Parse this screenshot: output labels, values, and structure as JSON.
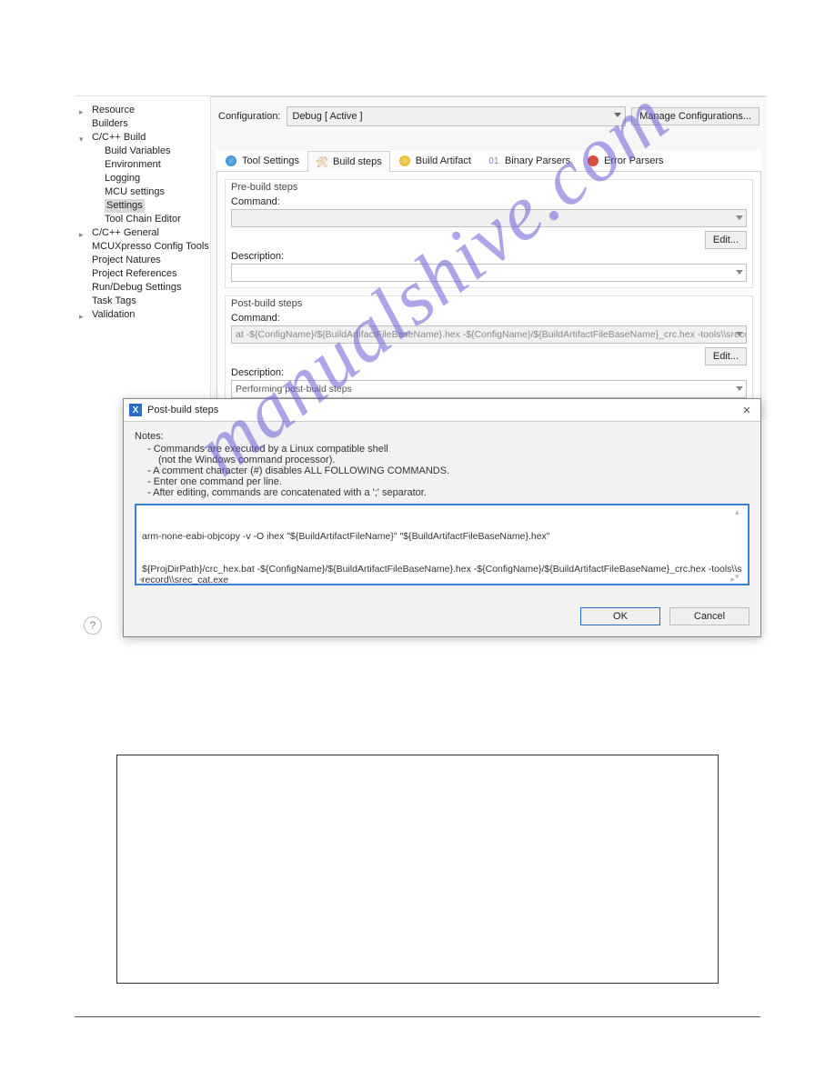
{
  "tree": {
    "resource": "Resource",
    "builders": "Builders",
    "ccbuild": "C/C++ Build",
    "build_vars": "Build Variables",
    "environment": "Environment",
    "logging": "Logging",
    "mcu_settings": "MCU settings",
    "settings": "Settings",
    "toolchain": "Tool Chain Editor",
    "ccgeneral": "C/C++ General",
    "mcux": "MCUXpresso Config Tools",
    "natures": "Project Natures",
    "refs": "Project References",
    "rundebug": "Run/Debug Settings",
    "tasktags": "Task Tags",
    "validation": "Validation"
  },
  "config": {
    "label": "Configuration:",
    "value": "Debug  [ Active ]",
    "manage": "Manage Configurations..."
  },
  "tabs": {
    "tool_settings": "Tool Settings",
    "build_steps": "Build steps",
    "build_artifact": "Build Artifact",
    "binary_parsers": "Binary Parsers",
    "error_parsers": "Error Parsers"
  },
  "prebuild": {
    "legend": "Pre-build steps",
    "cmd_label": "Command:",
    "cmd_value": "",
    "desc_label": "Description:",
    "desc_value": "",
    "edit": "Edit..."
  },
  "postbuild": {
    "legend": "Post-build steps",
    "cmd_label": "Command:",
    "cmd_value": "at -${ConfigName}/${BuildArtifactFileBaseName}.hex -${ConfigName}/${BuildArtifactFileBaseName}_crc.hex -tools\\\\srecord\\\\srec_cat.exe",
    "desc_label": "Description:",
    "desc_value": "Performing post-build steps",
    "edit": "Edit..."
  },
  "dialog": {
    "title": "Post-build steps",
    "notes_head": "Notes:",
    "note1": "- Commands are executed by a Linux compatible shell",
    "note1b": "(not the Windows command processor).",
    "note2": "- A comment character (#) disables ALL FOLLOWING COMMANDS.",
    "note3": "- Enter one command per line.",
    "note4": "- After editing, commands are concatenated with a ';' separator.",
    "ta_line1": "arm-none-eabi-objcopy -v -O ihex \"${BuildArtifactFileName}\" \"${BuildArtifactFileBaseName}.hex\"",
    "ta_line2": "${ProjDirPath}/crc_hex.bat -${ConfigName}/${BuildArtifactFileBaseName}.hex -${ConfigName}/${BuildArtifactFileBaseName}_crc.hex -tools\\\\srecord\\\\srec_cat.exe",
    "ok": "OK",
    "cancel": "Cancel"
  },
  "watermark": "manualshive.com"
}
